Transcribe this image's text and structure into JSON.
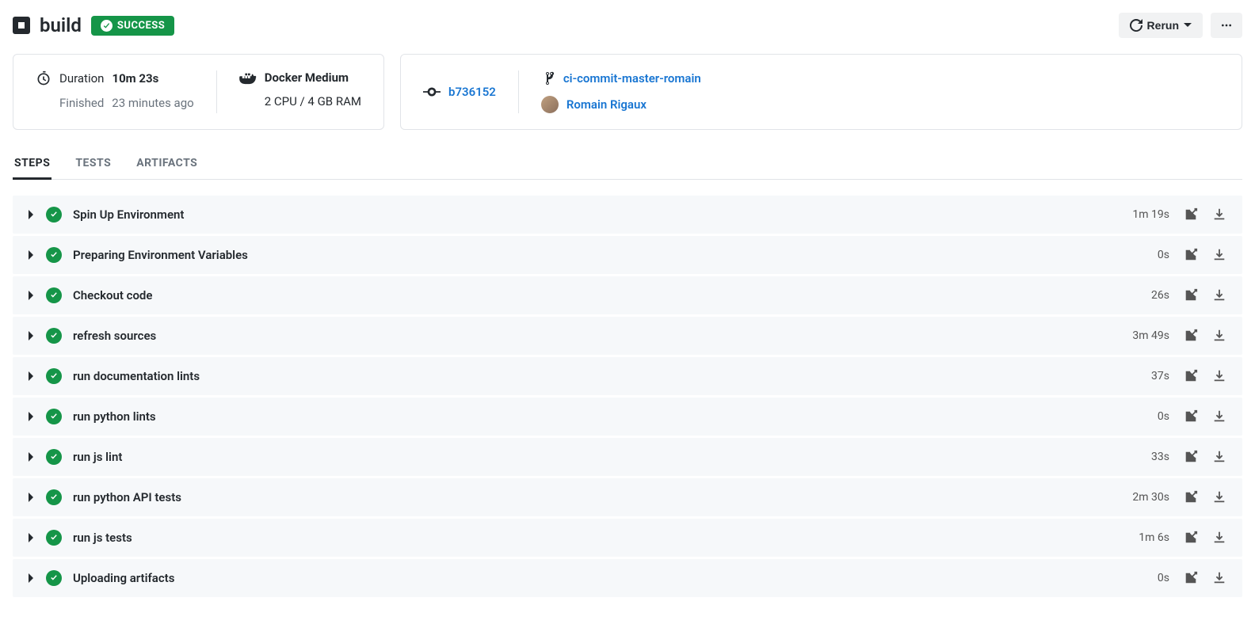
{
  "header": {
    "title": "build",
    "status": "SUCCESS",
    "rerun_label": "Rerun"
  },
  "summary": {
    "duration_label": "Duration",
    "duration_value": "10m 23s",
    "finished_label": "Finished",
    "finished_value": "23 minutes ago",
    "executor_name": "Docker Medium",
    "executor_spec": "2 CPU / 4 GB RAM",
    "commit_hash": "b736152",
    "branch": "ci-commit-master-romain",
    "author": "Romain Rigaux"
  },
  "tabs": [
    {
      "label": "STEPS",
      "active": true
    },
    {
      "label": "TESTS",
      "active": false
    },
    {
      "label": "ARTIFACTS",
      "active": false
    }
  ],
  "steps": [
    {
      "name": "Spin Up Environment",
      "duration": "1m 19s"
    },
    {
      "name": "Preparing Environment Variables",
      "duration": "0s"
    },
    {
      "name": "Checkout code",
      "duration": "26s"
    },
    {
      "name": "refresh sources",
      "duration": "3m 49s"
    },
    {
      "name": "run documentation lints",
      "duration": "37s"
    },
    {
      "name": "run python lints",
      "duration": "0s"
    },
    {
      "name": "run js lint",
      "duration": "33s"
    },
    {
      "name": "run python API tests",
      "duration": "2m 30s"
    },
    {
      "name": "run js tests",
      "duration": "1m 6s"
    },
    {
      "name": "Uploading artifacts",
      "duration": "0s"
    }
  ]
}
